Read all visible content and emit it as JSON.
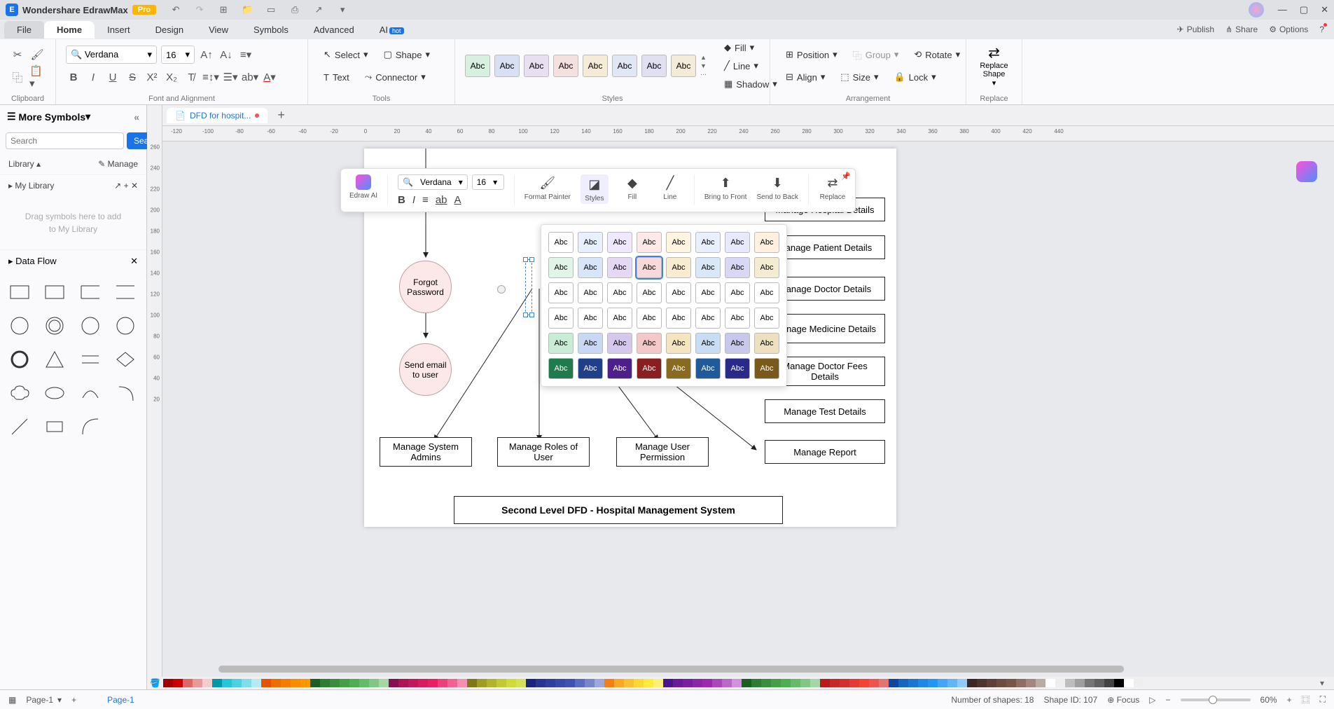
{
  "app": {
    "name": "Wondershare EdrawMax",
    "badge": "Pro"
  },
  "menu": {
    "file": "File",
    "home": "Home",
    "insert": "Insert",
    "design": "Design",
    "view": "View",
    "symbols": "Symbols",
    "advanced": "Advanced",
    "ai": "AI",
    "hot": "hot",
    "publish": "Publish",
    "share": "Share",
    "options": "Options"
  },
  "ribbon": {
    "clipboard": "Clipboard",
    "font_alignment": "Font and Alignment",
    "tools": "Tools",
    "styles": "Styles",
    "arrangement": "Arrangement",
    "replace": "Replace",
    "font": "Verdana",
    "fontsize": "16",
    "select": "Select",
    "shape": "Shape",
    "text": "Text",
    "connector": "Connector",
    "fill": "Fill",
    "line": "Line",
    "shadow": "Shadow",
    "position": "Position",
    "group": "Group",
    "rotate": "Rotate",
    "align": "Align",
    "size": "Size",
    "lock": "Lock",
    "replace_shape": "Replace\nShape",
    "style_swatch_text": "Abc"
  },
  "left": {
    "more_symbols": "More Symbols",
    "search_btn": "Search",
    "search_placeholder": "Search",
    "library": "Library",
    "manage": "Manage",
    "my_library": "My Library",
    "drag_msg": "Drag symbols here to add to My Library",
    "data_flow": "Data Flow"
  },
  "doc": {
    "tab": "DFD for hospit..."
  },
  "float": {
    "edraw_ai": "Edraw AI",
    "font": "Verdana",
    "size": "16",
    "format_painter": "Format Painter",
    "styles": "Styles",
    "fill": "Fill",
    "line": "Line",
    "bring_front": "Bring to Front",
    "send_back": "Send to Back",
    "replace": "Replace"
  },
  "shapes": {
    "forgot_password": "Forgot Password",
    "send_email": "Send email to user",
    "manage_hospital": "Manage Hospital Details",
    "manage_patient": "Manage Patient Details",
    "manage_doctor": "Manage Doctor Details",
    "manage_medicine": "Manage Medicine Details",
    "manage_fees": "Manage Doctor Fees Details",
    "manage_test": "Manage Test Details",
    "manage_report": "Manage Report",
    "manage_admins": "Manage System Admins",
    "manage_roles": "Manage Roles of User",
    "manage_perm": "Manage User Permission",
    "title": "Second Level DFD - Hospital Management System"
  },
  "status": {
    "page": "Page-1",
    "page_tab": "Page-1",
    "shapes": "Number of shapes: 18",
    "shape_id": "Shape ID: 107",
    "focus": "Focus",
    "zoom": "60%"
  },
  "ruler_h": [
    "-120",
    "-100",
    "-80",
    "-60",
    "-40",
    "-20",
    "0",
    "20",
    "40",
    "60",
    "80",
    "100",
    "120",
    "140",
    "160",
    "180",
    "200",
    "220",
    "240",
    "260",
    "280",
    "300",
    "320",
    "340",
    "360",
    "380",
    "400",
    "420",
    "440"
  ],
  "ruler_v": [
    "260",
    "240",
    "220",
    "200",
    "180",
    "160",
    "140",
    "120",
    "100",
    "80",
    "60",
    "40",
    "20"
  ],
  "palette": [
    "#a00000",
    "#cc0000",
    "#e06666",
    "#ea9999",
    "#f4cccc",
    "#0097a7",
    "#26c6da",
    "#4dd0e1",
    "#80deea",
    "#b2ebf2",
    "#e65100",
    "#ef6c00",
    "#f57c00",
    "#fb8c00",
    "#ff9800",
    "#1b5e20",
    "#2e7d32",
    "#388e3c",
    "#43a047",
    "#4caf50",
    "#66bb6a",
    "#81c784",
    "#a5d6a7",
    "#880e4f",
    "#ad1457",
    "#c2185b",
    "#d81b60",
    "#e91e63",
    "#ec407a",
    "#f06292",
    "#f48fb1",
    "#827717",
    "#9e9d24",
    "#afb42b",
    "#c0ca33",
    "#cddc39",
    "#d4e157",
    "#1a237e",
    "#283593",
    "#303f9f",
    "#3949ab",
    "#3f51b5",
    "#5c6bc0",
    "#7986cb",
    "#9fa8da",
    "#f57f17",
    "#f9a825",
    "#fbc02d",
    "#fdd835",
    "#ffeb3b",
    "#fff176",
    "#4a148c",
    "#6a1b9a",
    "#7b1fa2",
    "#8e24aa",
    "#9c27b0",
    "#ab47bc",
    "#ba68c8",
    "#ce93d8",
    "#1b5e20",
    "#2e7d32",
    "#388e3c",
    "#43a047",
    "#4caf50",
    "#66bb6a",
    "#81c784",
    "#a5d6a7",
    "#b71c1c",
    "#c62828",
    "#d32f2f",
    "#e53935",
    "#f44336",
    "#ef5350",
    "#e57373",
    "#0d47a1",
    "#1565c0",
    "#1976d2",
    "#1e88e5",
    "#2196f3",
    "#42a5f5",
    "#64b5f6",
    "#90caf9",
    "#3e2723",
    "#4e342e",
    "#5d4037",
    "#6d4c41",
    "#795548",
    "#8d6e63",
    "#a1887f",
    "#bcaaa4",
    "#ffffff",
    "#eeeeee",
    "#bdbdbd",
    "#9e9e9e",
    "#757575",
    "#616161",
    "#424242",
    "#000000",
    "#ffffff",
    "#eeeeee"
  ]
}
